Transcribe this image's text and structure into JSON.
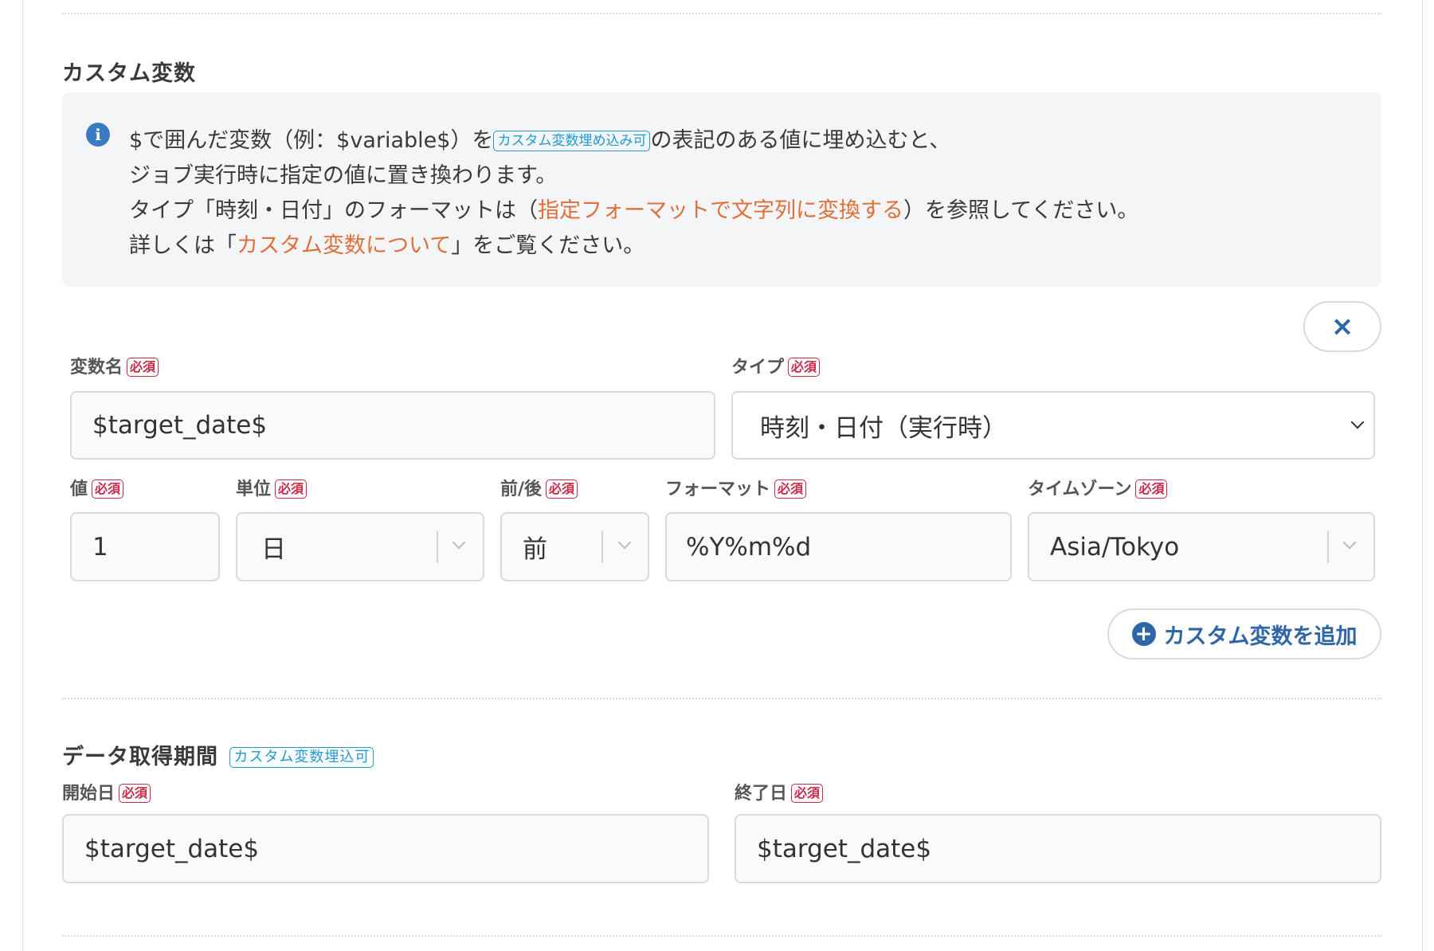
{
  "custom_vars": {
    "title": "カスタム変数",
    "info": {
      "line1_a": "$で囲んだ変数（例：$variable$）を",
      "line1_tag": "カスタム変数埋め込み可",
      "line1_b": "の表記のある値に埋め込むと、",
      "line2": "ジョブ実行時に指定の値に置き換わります。",
      "line3_a": "タイプ「時刻・日付」のフォーマットは（",
      "line3_link": "指定フォーマットで文字列に変換する",
      "line3_b": "）を参照してください。",
      "line4_a": "詳しくは「",
      "line4_link": "カスタム変数について",
      "line4_b": "」をご覧ください。"
    },
    "required_label": "必須",
    "name_label": "変数名",
    "name_value": "$target_date$",
    "type_label": "タイプ",
    "type_value": "時刻・日付（実行時）",
    "value_label": "値",
    "value_value": "1",
    "unit_label": "単位",
    "unit_value": "日",
    "direction_label": "前/後",
    "direction_value": "前",
    "format_label": "フォーマット",
    "format_value": "%Y%m%d",
    "timezone_label": "タイムゾーン",
    "timezone_value": "Asia/Tokyo",
    "remove_icon": "×",
    "add_button_icon": "+",
    "add_button_label": "カスタム変数を追加"
  },
  "period": {
    "title": "データ取得期間",
    "tag": "カスタム変数埋込可",
    "start_label": "開始日",
    "start_value": "$target_date$",
    "end_label": "終了日",
    "end_value": "$target_date$"
  },
  "colors": {
    "accent_blue": "#2f66a7",
    "link_orange": "#e06f39",
    "required_red": "#c62a47",
    "tag_cyan": "#1f9bd1"
  }
}
